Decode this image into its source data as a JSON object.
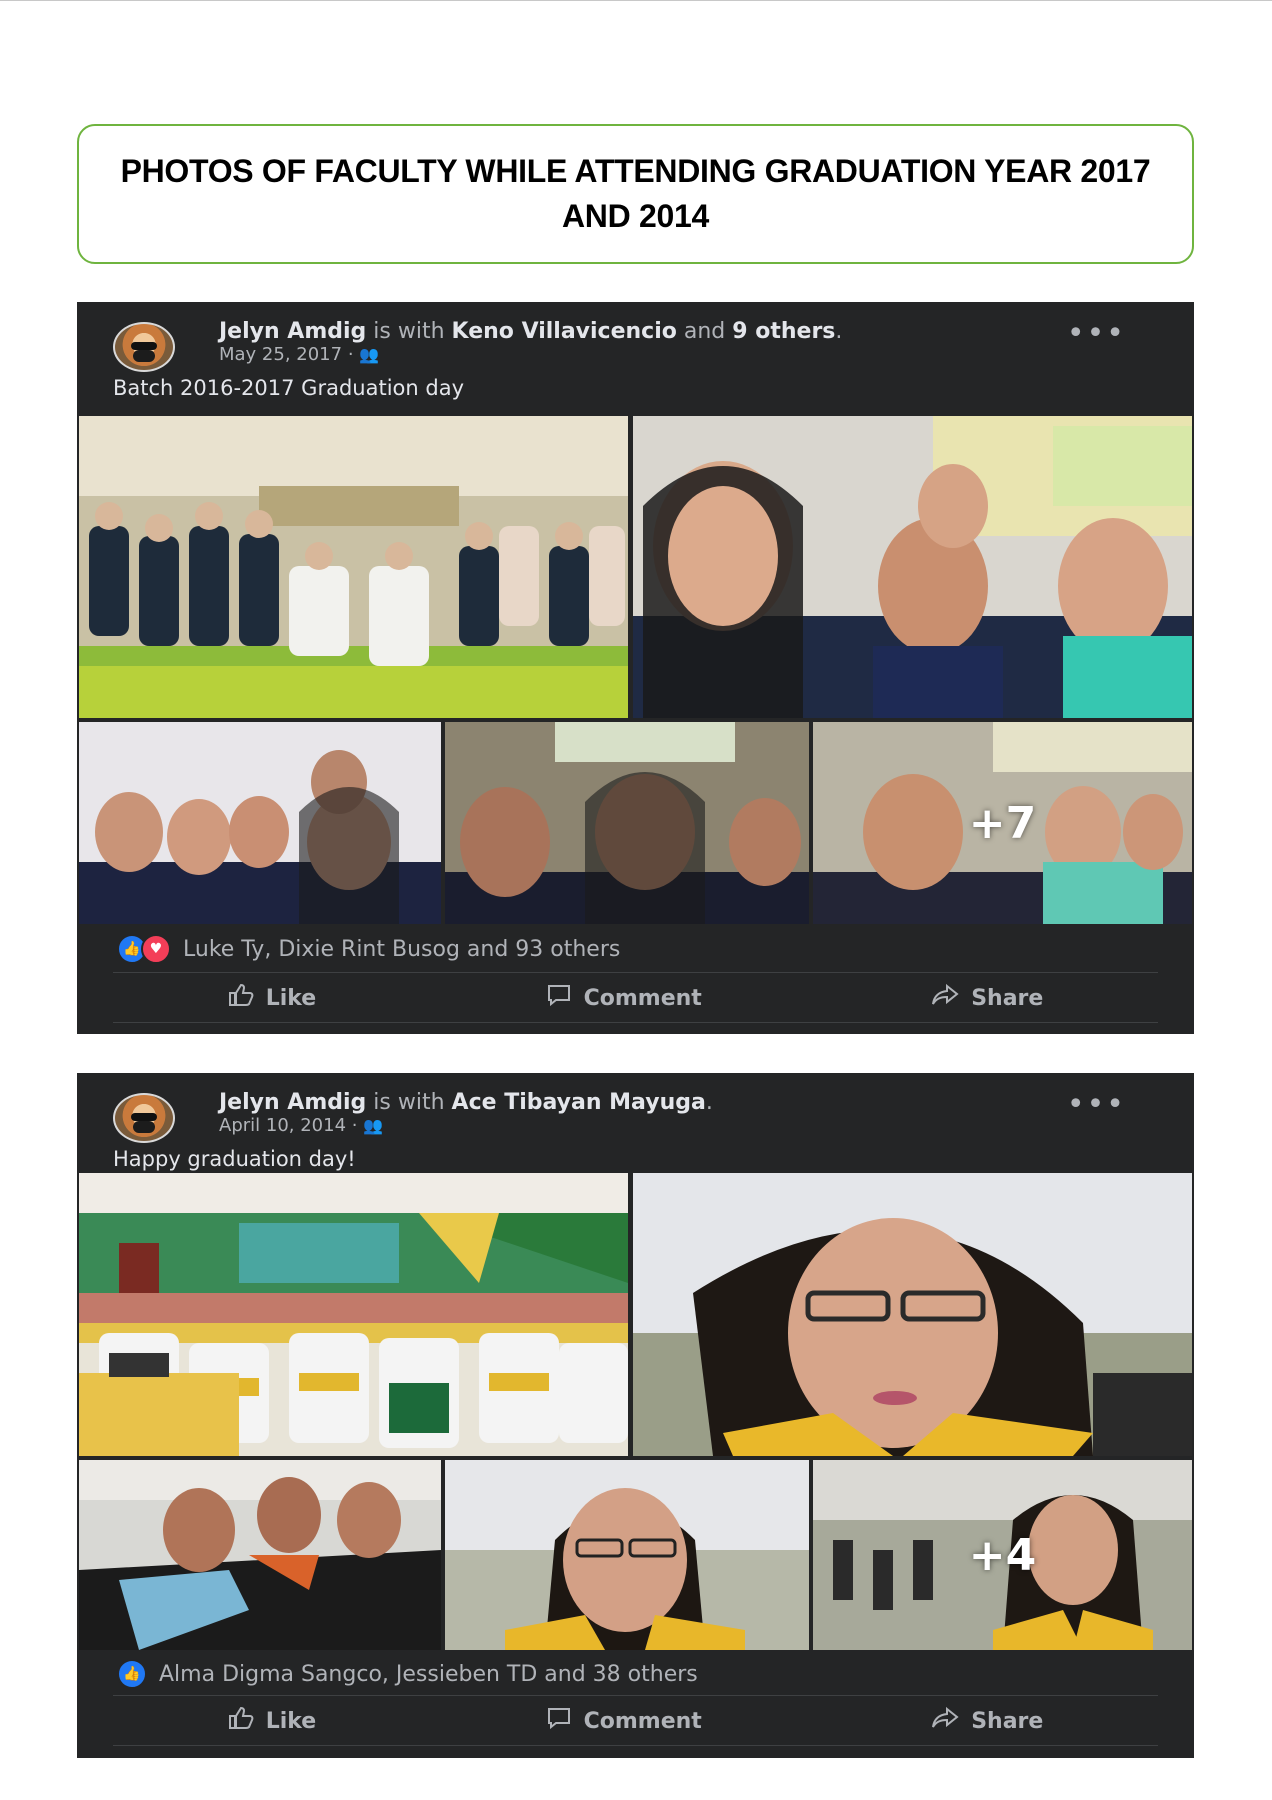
{
  "page": {
    "title": "PHOTOS OF FACULTY WHILE ATTENDING GRADUATION YEAR 2017 AND 2014"
  },
  "posts": [
    {
      "author": "Jelyn Amdig",
      "is_with": "is with",
      "tagged": "Keno Villavicencio",
      "and_text": "and",
      "others": "9 others",
      "end": ".",
      "date": "May 25, 2017 ·",
      "audience_icon": "friends-icon",
      "caption": "Batch 2016-2017 Graduation day",
      "photo_overlay": "+7",
      "reactions_text": "Luke Ty, Dixie Rint Busog and 93 others",
      "actions": {
        "like": "Like",
        "comment": "Comment",
        "share": "Share"
      }
    },
    {
      "author": "Jelyn Amdig",
      "is_with": "is with",
      "tagged": "Ace Tibayan Mayuga",
      "end": ".",
      "date": "April 10, 2014 ·",
      "audience_icon": "friends-icon",
      "caption": "Happy graduation day!",
      "photo_overlay": "+4",
      "reactions_text": "Alma Digma Sangco, Jessieben TD and 38 others",
      "actions": {
        "like": "Like",
        "comment": "Comment",
        "share": "Share"
      }
    }
  ],
  "colors": {
    "title_border": "#6fb43f",
    "post_background": "#242526",
    "like_blue": "#2078f4",
    "love_red": "#f33e58"
  }
}
